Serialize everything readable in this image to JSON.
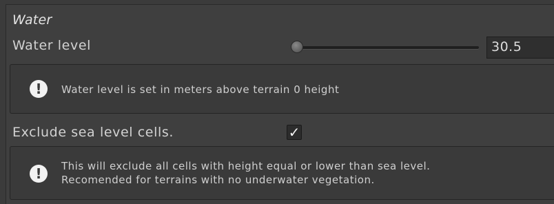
{
  "section": {
    "title": "Water"
  },
  "water_level": {
    "label": "Water level",
    "value": "30.5",
    "slider_fraction": 0.0
  },
  "help_water": {
    "icon": "exclamation-icon",
    "text": "Water level is set in meters above terrain 0 height"
  },
  "exclude": {
    "label": "Exclude sea level cells.",
    "checked": true,
    "check_glyph": "✓"
  },
  "help_exclude": {
    "icon": "exclamation-icon",
    "line1": "This will exclude all cells with height equal or lower than sea level.",
    "line2": "Recomended  for terrains with no underwater vegetation."
  }
}
